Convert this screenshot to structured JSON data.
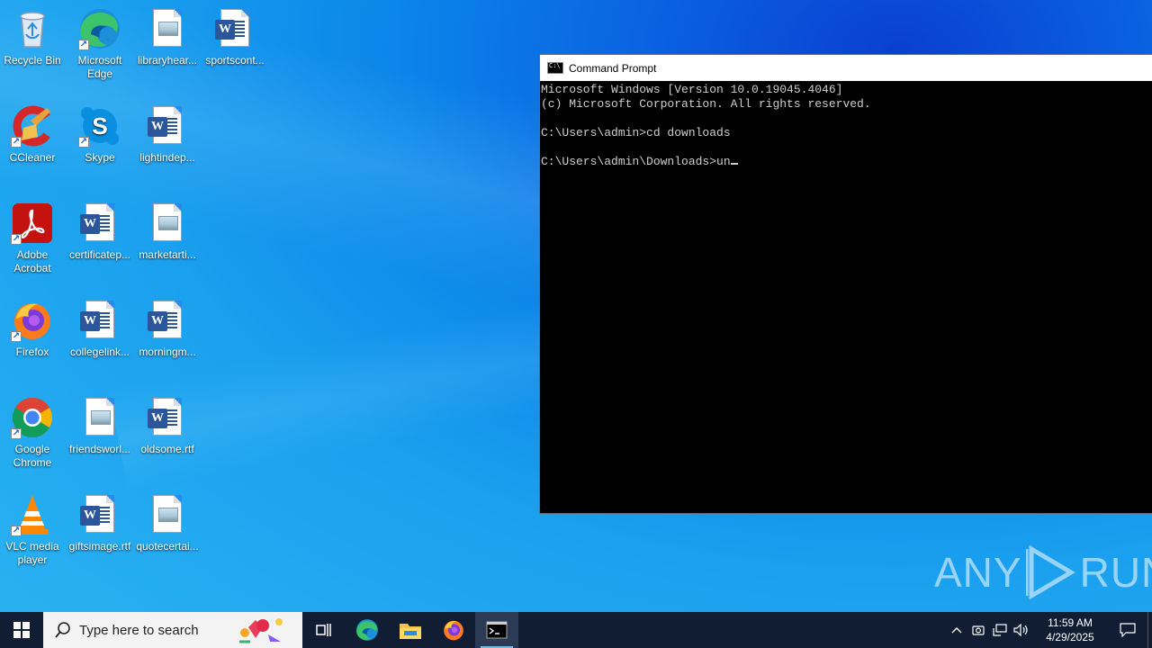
{
  "desktop": {
    "icons": [
      {
        "label": "Recycle Bin",
        "icon": "recycle-bin-icon"
      },
      {
        "label": "Microsoft Edge",
        "icon": "edge-icon"
      },
      {
        "label": "libraryhear...",
        "icon": "image-file-icon"
      },
      {
        "label": "sportscont...",
        "icon": "word-doc-icon"
      },
      {
        "label": "CCleaner",
        "icon": "ccleaner-icon"
      },
      {
        "label": "Skype",
        "icon": "skype-icon"
      },
      {
        "label": "lightindep...",
        "icon": "word-doc-icon"
      },
      {
        "label": "Adobe Acrobat",
        "icon": "acrobat-icon"
      },
      {
        "label": "certificatep...",
        "icon": "word-doc-icon"
      },
      {
        "label": "marketarti...",
        "icon": "image-file-icon"
      },
      {
        "label": "Firefox",
        "icon": "firefox-icon"
      },
      {
        "label": "collegelink...",
        "icon": "word-doc-icon"
      },
      {
        "label": "morningm...",
        "icon": "word-doc-icon"
      },
      {
        "label": "Google Chrome",
        "icon": "chrome-icon"
      },
      {
        "label": "friendsworl...",
        "icon": "image-file-icon"
      },
      {
        "label": "oldsome.rtf",
        "icon": "word-doc-icon"
      },
      {
        "label": "VLC media player",
        "icon": "vlc-icon"
      },
      {
        "label": "giftsimage.rtf",
        "icon": "word-doc-icon"
      },
      {
        "label": "quotecertai...",
        "icon": "image-file-icon"
      }
    ]
  },
  "cmd": {
    "title": "Command Prompt",
    "lines": [
      "Microsoft Windows [Version 10.0.19045.4046]",
      "(c) Microsoft Corporation. All rights reserved.",
      "",
      "C:\\Users\\admin>cd downloads",
      "",
      "C:\\Users\\admin\\Downloads>un"
    ]
  },
  "watermark": {
    "left": "ANY",
    "right": "RUN"
  },
  "taskbar": {
    "search_placeholder": "Type here to search",
    "clock_time": "11:59 AM",
    "clock_date": "4/29/2025"
  },
  "colors": {
    "taskbar_bg": "#101d33",
    "cmd_text": "#cccccc",
    "active_indicator": "#76b9ed"
  }
}
